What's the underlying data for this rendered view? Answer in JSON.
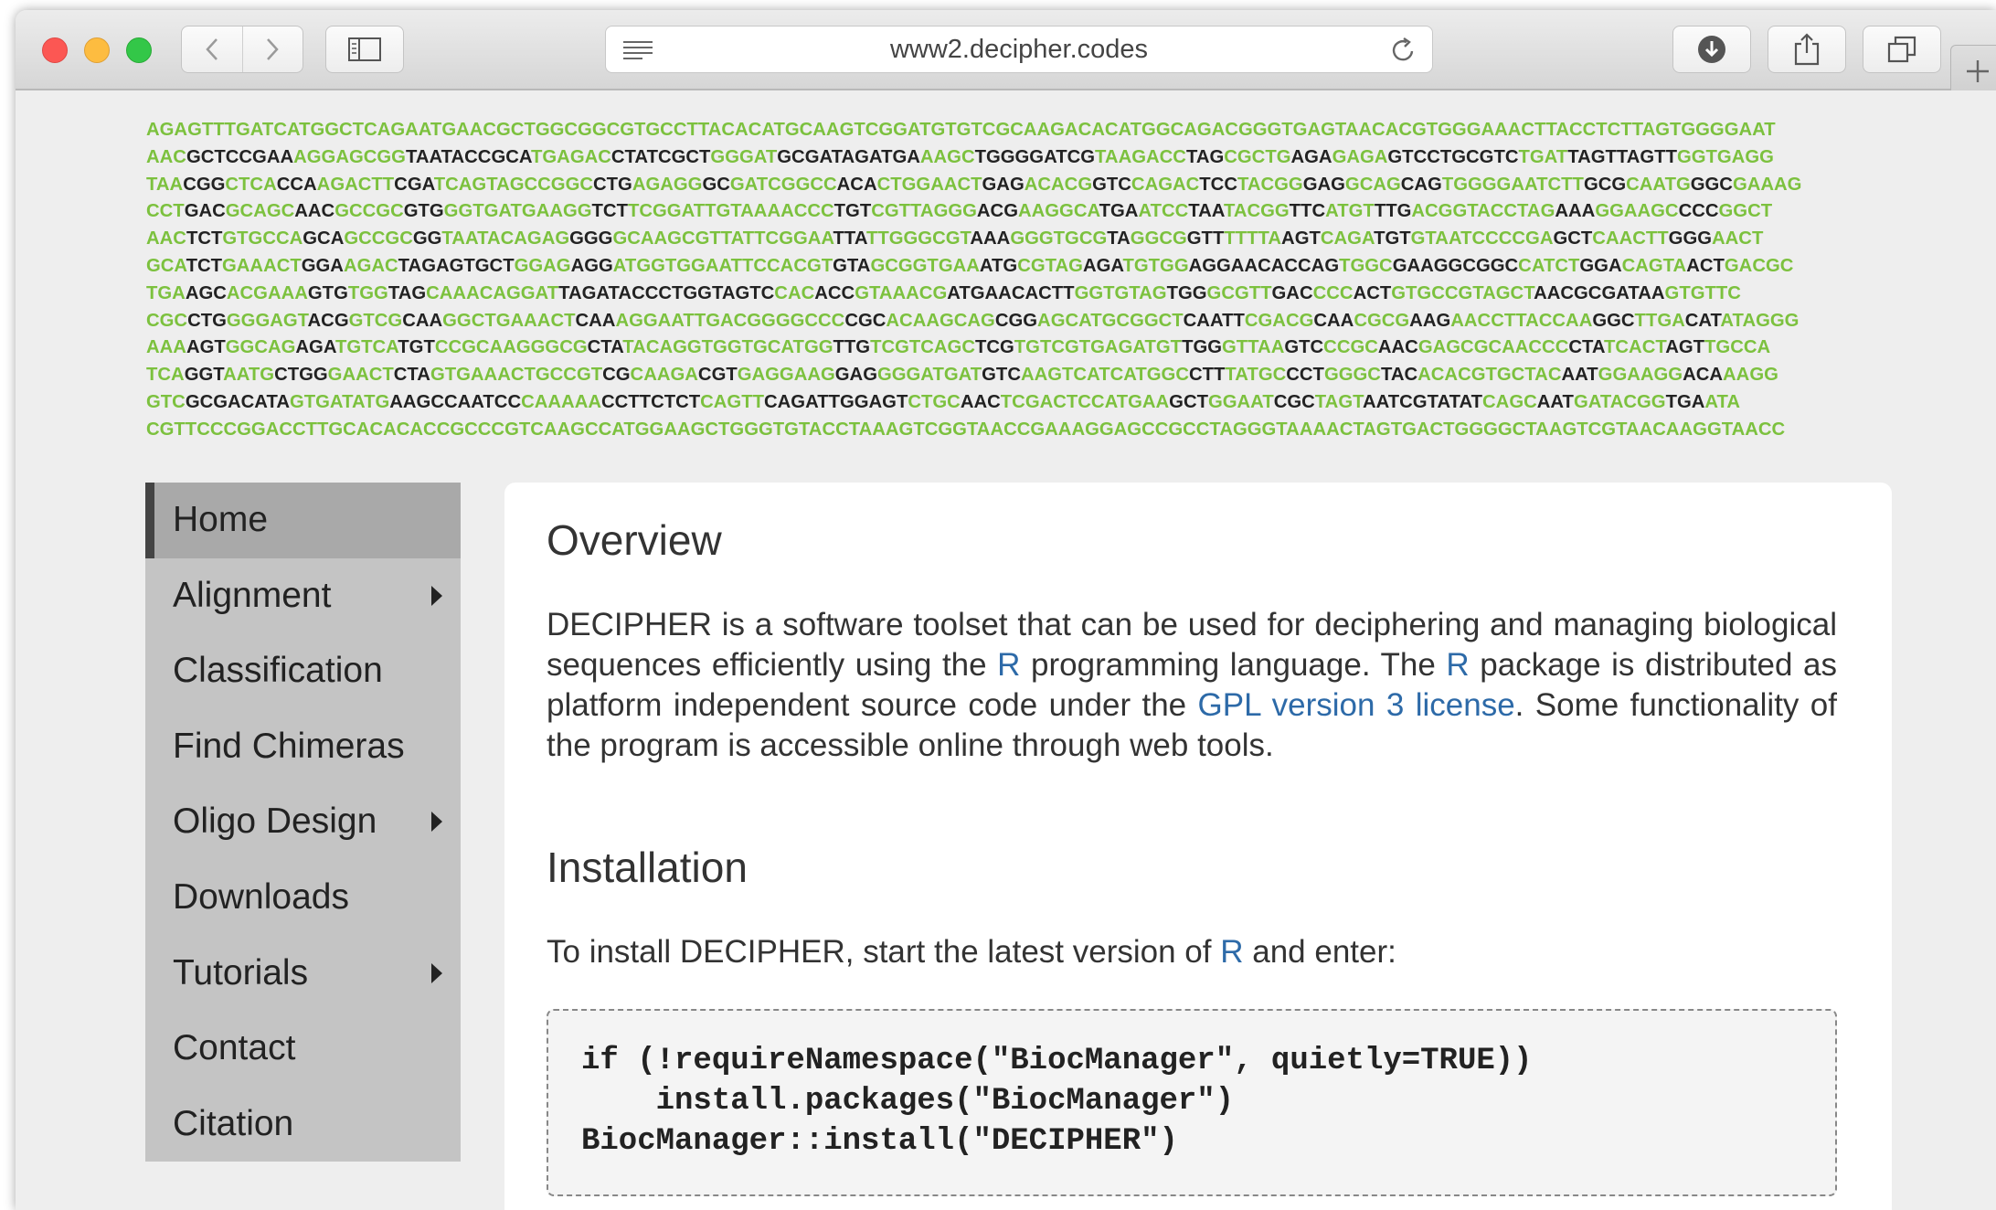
{
  "browser": {
    "url": "www2.decipher.codes"
  },
  "dna_rows": [
    [
      [
        "g",
        "AGAGTTTGATCATGGCTCAGAATGAACGCTGGCGGCGTGCCTTACACATGCAAGTCGGATGTGTCGCAAGACACATGGCAGACGGGTGAGTAACACGTGGGAAACTTACCTCTTAGTGGGGAAT"
      ]
    ],
    [
      [
        "g",
        "AAC"
      ],
      [
        "k",
        "GCTCCGAA"
      ],
      [
        "g",
        "AGGAGCGG"
      ],
      [
        "k",
        "TAATACCGCA"
      ],
      [
        "g",
        "TGAGAC"
      ],
      [
        "k",
        "CTATCGCT"
      ],
      [
        "g",
        "GGGAT"
      ],
      [
        "k",
        "GCGATAGATGA"
      ],
      [
        "g",
        "AAGC"
      ],
      [
        "k",
        "TGGGGATCG"
      ],
      [
        "g",
        "TAAGACC"
      ],
      [
        "k",
        "TAG"
      ],
      [
        "g",
        "CGCTG"
      ],
      [
        "k",
        "AGA"
      ],
      [
        "g",
        "GAGA"
      ],
      [
        "k",
        "GTCCTGCGTC"
      ],
      [
        "g",
        "TGAT"
      ],
      [
        "k",
        "TAGTTAGTT"
      ],
      [
        "g",
        "GGTGAGG"
      ]
    ],
    [
      [
        "g",
        "TAA"
      ],
      [
        "k",
        "CGG"
      ],
      [
        "g",
        "CTCA"
      ],
      [
        "k",
        "CCA"
      ],
      [
        "g",
        "AGACTT"
      ],
      [
        "k",
        "CGA"
      ],
      [
        "g",
        "TCAGTAGCCGGC"
      ],
      [
        "k",
        "CTG"
      ],
      [
        "g",
        "AGAGG"
      ],
      [
        "k",
        "GC"
      ],
      [
        "g",
        "GATCGGCC"
      ],
      [
        "k",
        "ACA"
      ],
      [
        "g",
        "CTGGAACT"
      ],
      [
        "k",
        "GAG"
      ],
      [
        "g",
        "ACACG"
      ],
      [
        "k",
        "GTC"
      ],
      [
        "g",
        "CAGAC"
      ],
      [
        "k",
        "TCC"
      ],
      [
        "g",
        "TACGG"
      ],
      [
        "k",
        "GAG"
      ],
      [
        "g",
        "GCAG"
      ],
      [
        "k",
        "CAG"
      ],
      [
        "g",
        "TGGGGAATCTT"
      ],
      [
        "k",
        "GCG"
      ],
      [
        "g",
        "CAATG"
      ],
      [
        "k",
        "GGC"
      ],
      [
        "g",
        "GAAAG"
      ]
    ],
    [
      [
        "g",
        "CCT"
      ],
      [
        "k",
        "GAC"
      ],
      [
        "g",
        "GCAGC"
      ],
      [
        "k",
        "AAC"
      ],
      [
        "g",
        "GCCGC"
      ],
      [
        "k",
        "GTG"
      ],
      [
        "g",
        "GGTGATGAAGG"
      ],
      [
        "k",
        "TCT"
      ],
      [
        "g",
        "TCGGATTGTAAAACCC"
      ],
      [
        "k",
        "TGT"
      ],
      [
        "g",
        "CGTTAGGG"
      ],
      [
        "k",
        "ACG"
      ],
      [
        "g",
        "AAGGCA"
      ],
      [
        "k",
        "TGA"
      ],
      [
        "g",
        "ATCC"
      ],
      [
        "k",
        "TAA"
      ],
      [
        "g",
        "TACGG"
      ],
      [
        "k",
        "TTC"
      ],
      [
        "g",
        "ATGT"
      ],
      [
        "k",
        "TTG"
      ],
      [
        "g",
        "ACGGTACCTAG"
      ],
      [
        "k",
        "AAA"
      ],
      [
        "g",
        "GGAAGC"
      ],
      [
        "k",
        "CCC"
      ],
      [
        "g",
        "GGCT"
      ]
    ],
    [
      [
        "g",
        "AAC"
      ],
      [
        "k",
        "TCT"
      ],
      [
        "g",
        "GTGCCA"
      ],
      [
        "k",
        "GCA"
      ],
      [
        "g",
        "GCCGC"
      ],
      [
        "k",
        "GG"
      ],
      [
        "g",
        "TAATACAGAG"
      ],
      [
        "k",
        "GGG"
      ],
      [
        "g",
        "GCAAGCGTTATTCGGAA"
      ],
      [
        "k",
        "TTA"
      ],
      [
        "g",
        "TTGGGCGT"
      ],
      [
        "k",
        "AAA"
      ],
      [
        "g",
        "GGGTGCG"
      ],
      [
        "k",
        "TA"
      ],
      [
        "g",
        "GGCG"
      ],
      [
        "k",
        "GTT"
      ],
      [
        "g",
        "TTTTA"
      ],
      [
        "k",
        "AGT"
      ],
      [
        "g",
        "CAGA"
      ],
      [
        "k",
        "TGT"
      ],
      [
        "g",
        "GTAATCCCCGA"
      ],
      [
        "k",
        "GCT"
      ],
      [
        "g",
        "CAACTT"
      ],
      [
        "k",
        "GGG"
      ],
      [
        "g",
        "AACT"
      ]
    ],
    [
      [
        "g",
        "GCA"
      ],
      [
        "k",
        "TCT"
      ],
      [
        "g",
        "GAAACT"
      ],
      [
        "k",
        "GGA"
      ],
      [
        "g",
        "AGAC"
      ],
      [
        "k",
        "TAGAGTGCT"
      ],
      [
        "g",
        "GGAG"
      ],
      [
        "k",
        "AGG"
      ],
      [
        "g",
        "ATGGTGGAATTCCACGT"
      ],
      [
        "k",
        "GTA"
      ],
      [
        "g",
        "GCGGTGAA"
      ],
      [
        "k",
        "ATG"
      ],
      [
        "g",
        "CGTAG"
      ],
      [
        "k",
        "AGA"
      ],
      [
        "g",
        "TGTGG"
      ],
      [
        "k",
        "AGGAACACCAG"
      ],
      [
        "g",
        "TGGC"
      ],
      [
        "k",
        "GAAGGCGGC"
      ],
      [
        "g",
        "CATCT"
      ],
      [
        "k",
        "GGA"
      ],
      [
        "g",
        "CAGTA"
      ],
      [
        "k",
        "ACT"
      ],
      [
        "g",
        "GACGC"
      ]
    ],
    [
      [
        "g",
        "TGA"
      ],
      [
        "k",
        "AGC"
      ],
      [
        "g",
        "ACGAAA"
      ],
      [
        "k",
        "GTG"
      ],
      [
        "g",
        "TGG"
      ],
      [
        "k",
        "TAG"
      ],
      [
        "g",
        "CAAACAGGAT"
      ],
      [
        "k",
        "TAGATACCCTGGTAGTC"
      ],
      [
        "g",
        "CAC"
      ],
      [
        "k",
        "ACC"
      ],
      [
        "g",
        "GTAAACG"
      ],
      [
        "k",
        "ATGAACACTT"
      ],
      [
        "g",
        "GGTGTAG"
      ],
      [
        "k",
        "TGG"
      ],
      [
        "g",
        "GCGTT"
      ],
      [
        "k",
        "GAC"
      ],
      [
        "g",
        "CCC"
      ],
      [
        "k",
        "ACT"
      ],
      [
        "g",
        "GTGCCGTAGCT"
      ],
      [
        "k",
        "AACGCGATAA"
      ],
      [
        "g",
        "GTGTTC"
      ]
    ],
    [
      [
        "g",
        "CGC"
      ],
      [
        "k",
        "CTG"
      ],
      [
        "g",
        "GGGAGT"
      ],
      [
        "k",
        "ACG"
      ],
      [
        "g",
        "GTCG"
      ],
      [
        "k",
        "CAA"
      ],
      [
        "g",
        "GGCTGAAACT"
      ],
      [
        "k",
        "CAA"
      ],
      [
        "g",
        "AGGAATTGACGGGGCCC"
      ],
      [
        "k",
        "CGC"
      ],
      [
        "g",
        "ACAAGCAG"
      ],
      [
        "k",
        "CGG"
      ],
      [
        "g",
        "AGCATGCGGCT"
      ],
      [
        "k",
        "CAATT"
      ],
      [
        "g",
        "CGACG"
      ],
      [
        "k",
        "CAA"
      ],
      [
        "g",
        "CGCG"
      ],
      [
        "k",
        "AAG"
      ],
      [
        "g",
        "AACCTTACCAA"
      ],
      [
        "k",
        "GGC"
      ],
      [
        "g",
        "TTGA"
      ],
      [
        "k",
        "CAT"
      ],
      [
        "g",
        "ATAGGG"
      ]
    ],
    [
      [
        "g",
        "AAA"
      ],
      [
        "k",
        "AGT"
      ],
      [
        "g",
        "GGCAG"
      ],
      [
        "k",
        "AGA"
      ],
      [
        "g",
        "TGTCA"
      ],
      [
        "k",
        "TGT"
      ],
      [
        "g",
        "CCGCAAGGGCG"
      ],
      [
        "k",
        "CTA"
      ],
      [
        "g",
        "TACAGGTGGTGCATGG"
      ],
      [
        "k",
        "TTG"
      ],
      [
        "g",
        "TCGTCAGC"
      ],
      [
        "k",
        "TCG"
      ],
      [
        "g",
        "TGTCGTGAGATGT"
      ],
      [
        "k",
        "TGG"
      ],
      [
        "g",
        "GTTAA"
      ],
      [
        "k",
        "GTC"
      ],
      [
        "g",
        "CCGC"
      ],
      [
        "k",
        "AAC"
      ],
      [
        "g",
        "GAGCGCAACCC"
      ],
      [
        "k",
        "CTA"
      ],
      [
        "g",
        "TCACT"
      ],
      [
        "k",
        "AGT"
      ],
      [
        "g",
        "TGCCA"
      ]
    ],
    [
      [
        "g",
        "TCA"
      ],
      [
        "k",
        "GGT"
      ],
      [
        "g",
        "AATG"
      ],
      [
        "k",
        "CTGG"
      ],
      [
        "g",
        "GAACT"
      ],
      [
        "k",
        "CTA"
      ],
      [
        "g",
        "GTGAAACTGCCGT"
      ],
      [
        "k",
        "CG"
      ],
      [
        "g",
        "CAAGA"
      ],
      [
        "k",
        "CGT"
      ],
      [
        "g",
        "GAGGAAG"
      ],
      [
        "k",
        "GAG"
      ],
      [
        "g",
        "GGGATGAT"
      ],
      [
        "k",
        "GTC"
      ],
      [
        "g",
        "AAGTCATCATGGC"
      ],
      [
        "k",
        "CTT"
      ],
      [
        "g",
        "TATGC"
      ],
      [
        "k",
        "CCT"
      ],
      [
        "g",
        "GGGC"
      ],
      [
        "k",
        "TAC"
      ],
      [
        "g",
        "ACACGTGCTAC"
      ],
      [
        "k",
        "AAT"
      ],
      [
        "g",
        "GGAAGG"
      ],
      [
        "k",
        "ACA"
      ],
      [
        "g",
        "AAGG"
      ]
    ],
    [
      [
        "g",
        "GTC"
      ],
      [
        "k",
        "GCGACATA"
      ],
      [
        "g",
        "GTGATATG"
      ],
      [
        "k",
        "AAGCCAATCC"
      ],
      [
        "g",
        "CAAAAA"
      ],
      [
        "k",
        "CCTTCTCT"
      ],
      [
        "g",
        "CAGTT"
      ],
      [
        "k",
        "CAGATTGGAGT"
      ],
      [
        "g",
        "CTGC"
      ],
      [
        "k",
        "AAC"
      ],
      [
        "g",
        "TCGACTCCATGAA"
      ],
      [
        "k",
        "GCT"
      ],
      [
        "g",
        "GGAAT"
      ],
      [
        "k",
        "CGC"
      ],
      [
        "g",
        "TAGT"
      ],
      [
        "k",
        "AATCGTATAT"
      ],
      [
        "g",
        "CAGC"
      ],
      [
        "k",
        "AAT"
      ],
      [
        "g",
        "GATACGG"
      ],
      [
        "k",
        "TGA"
      ],
      [
        "g",
        "ATA"
      ]
    ],
    [
      [
        "g",
        "CGTTCCCGGACCTTGCACACACCGCCCGTCAAGCCATGGAAGCTGGGTGTACCTAAAGTCGGTAACCGAAAGGAGCCGCCTAGGGTAAAACTAGTGACTGGGGCTAAGTCGTAACAAGGTAACC"
      ]
    ]
  ],
  "sidebar": {
    "items": [
      {
        "label": "Home",
        "active": true,
        "submenu": false
      },
      {
        "label": "Alignment",
        "active": false,
        "submenu": true
      },
      {
        "label": "Classification",
        "active": false,
        "submenu": false
      },
      {
        "label": "Find Chimeras",
        "active": false,
        "submenu": false
      },
      {
        "label": "Oligo Design",
        "active": false,
        "submenu": true
      },
      {
        "label": "Downloads",
        "active": false,
        "submenu": false
      },
      {
        "label": "Tutorials",
        "active": false,
        "submenu": true
      },
      {
        "label": "Contact",
        "active": false,
        "submenu": false
      },
      {
        "label": "Citation",
        "active": false,
        "submenu": false
      }
    ]
  },
  "main": {
    "overview": {
      "heading": "Overview",
      "p1": "DECIPHER is a software toolset that can be used for deciphering and managing biological sequences efficiently using the ",
      "link_r1": "R",
      "p2": " programming language. The ",
      "link_r2": "R",
      "p3": " package is distributed as platform independent source code under the ",
      "link_gpl": "GPL version 3 license",
      "p4": ". Some functionality of the program is accessible online through web tools."
    },
    "installation": {
      "heading": "Installation",
      "text1": "To install DECIPHER, start the latest version of ",
      "link_r": "R",
      "text2": " and enter:",
      "code": "if (!requireNamespace(\"BiocManager\", quietly=TRUE))\n    install.packages(\"BiocManager\")\nBiocManager::install(\"DECIPHER\")"
    }
  },
  "colors": {
    "dna_green": "#7cc13e",
    "dna_black": "#222222",
    "link_blue": "#2d6aa8",
    "active_indicator": "#444444"
  }
}
